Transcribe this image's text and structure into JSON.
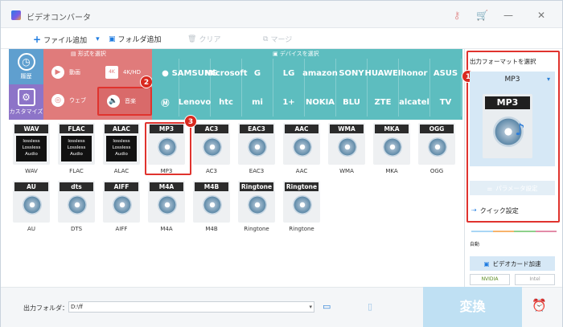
{
  "title": "ビデオコンバータ",
  "toolbar": {
    "add_file": "ファイル追加",
    "add_folder": "フォルダ追加",
    "clear": "クリア",
    "merge": "マージ"
  },
  "sidebar": {
    "history": "履歴",
    "customize": "カスタマイズ"
  },
  "format_section": {
    "header": "形式を選択",
    "video": "動画",
    "hd": "4K/HD",
    "web": "ウェブ",
    "audio": "音楽"
  },
  "device_section": {
    "header": "デバイスを選択",
    "row1": [
      "",
      "SAMSUNG",
      "Microsoft",
      "G",
      "LG",
      "amazon",
      "SONY",
      "HUAWEI",
      "honor",
      "ASUS"
    ],
    "row2": [
      "",
      "Lenovo",
      "htc",
      "mi",
      "1+",
      "NOKIA",
      "BLU",
      "ZTE",
      "alcatel",
      "TV"
    ]
  },
  "badges": [
    "1",
    "2",
    "3"
  ],
  "formats_row1": [
    {
      "label": "WAV",
      "name": "WAV",
      "lossless": true
    },
    {
      "label": "FLAC",
      "name": "FLAC",
      "lossless": true
    },
    {
      "label": "ALAC",
      "name": "ALAC",
      "lossless": true
    },
    {
      "label": "MP3",
      "name": "MP3",
      "lossless": false
    },
    {
      "label": "AC3",
      "name": "AC3",
      "lossless": false
    },
    {
      "label": "EAC3",
      "name": "EAC3",
      "lossless": false
    },
    {
      "label": "AAC",
      "name": "AAC",
      "lossless": false
    },
    {
      "label": "WMA",
      "name": "WMA",
      "lossless": false
    },
    {
      "label": "MKA",
      "name": "MKA",
      "lossless": false
    },
    {
      "label": "OGG",
      "name": "OGG",
      "lossless": false
    }
  ],
  "formats_row2": [
    {
      "label": "AU",
      "name": "AU"
    },
    {
      "label": "dts",
      "name": "DTS"
    },
    {
      "label": "AIFF",
      "name": "AIFF"
    },
    {
      "label": "M4A",
      "name": "M4A"
    },
    {
      "label": "M4B",
      "name": "M4B"
    },
    {
      "label": "Ringtone",
      "name": "Ringtone"
    },
    {
      "label": "Ringtone",
      "name": "Ringtone"
    }
  ],
  "lossless_text": "lossless\nLossless\nAudio",
  "output": {
    "header": "出力フォーマットを選択",
    "selected": "MP3",
    "big_label": "MP3",
    "param_settings": "パラメータ設定",
    "quick_settings": "クイック設定",
    "auto": "自動",
    "gpu_accel": "ビデオカード加速",
    "nvidia": "NVIDIA",
    "intel": "Intel"
  },
  "footer": {
    "folder_label": "出力フォルダ：",
    "folder_value": "D:\\ff",
    "convert": "変換"
  }
}
